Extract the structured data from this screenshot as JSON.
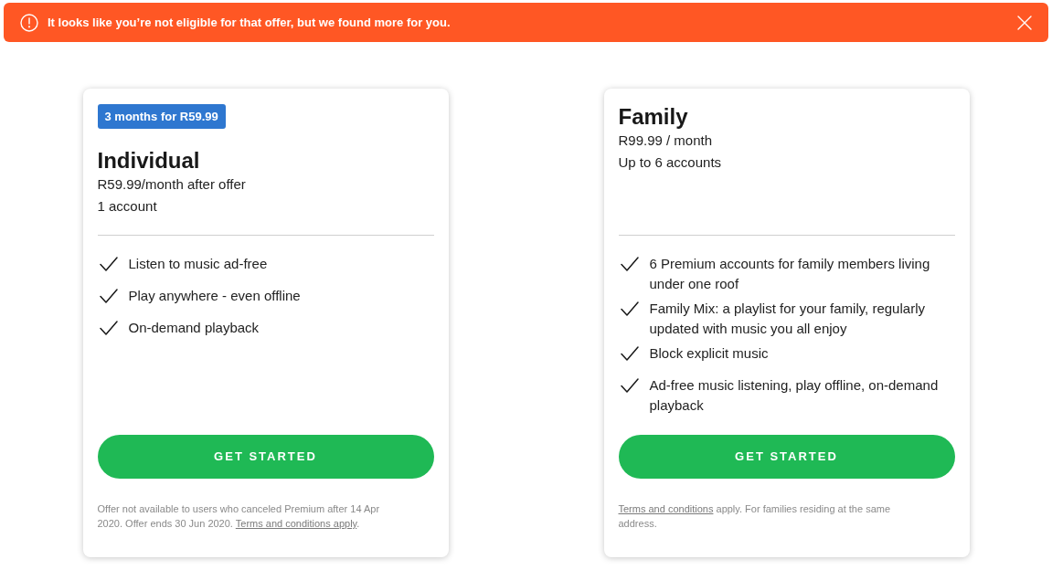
{
  "alert": {
    "message": "It looks like you’re not eligible for that offer, but we found more for you."
  },
  "plans": [
    {
      "badge": "3 months for R59.99",
      "name": "Individual",
      "price": "R59.99/month after offer",
      "accounts": "1 account",
      "features": [
        "Listen to music ad-free",
        "Play anywhere - even offline",
        "On-demand playback"
      ],
      "button": "GET STARTED",
      "footnote": {
        "before": "Offer not available to users who canceled Premium after 14 Apr 2020. Offer ends 30 Jun 2020. ",
        "link": "Terms and conditions apply",
        "after": "."
      }
    },
    {
      "name": "Family",
      "price": "R99.99 / month",
      "accounts": "Up to 6 accounts",
      "features": [
        "6 Premium accounts for family members living under one roof",
        "Family Mix: a playlist for your family, regularly updated with music you all enjoy",
        "Block explicit music",
        "Ad-free music listening, play offline, on-demand playback"
      ],
      "button": "GET STARTED",
      "footnote": {
        "link": "Terms and conditions",
        "after": " apply. For families residing at the same address."
      }
    }
  ]
}
